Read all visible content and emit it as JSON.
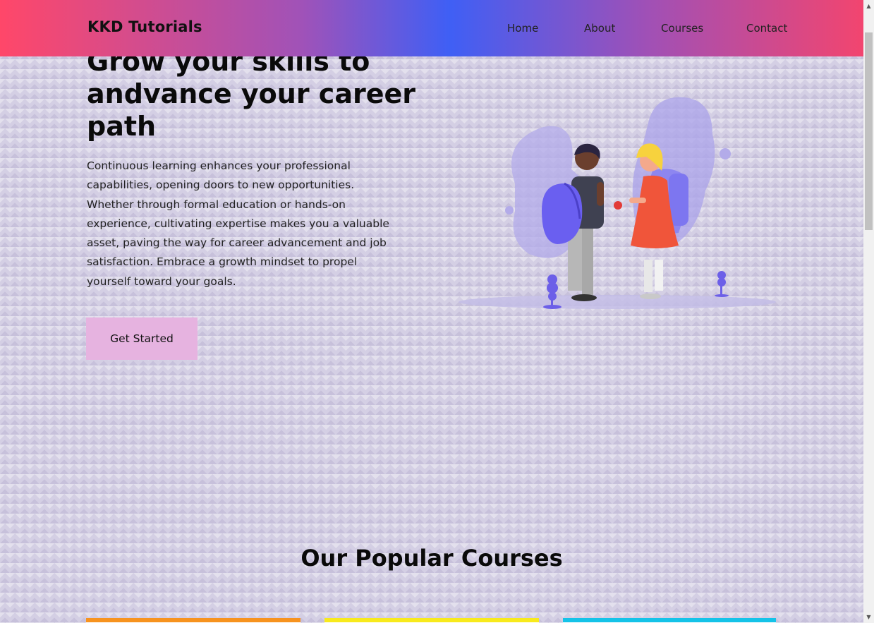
{
  "header": {
    "brand": "KKD Tutorials",
    "nav": [
      {
        "label": "Home"
      },
      {
        "label": "About"
      },
      {
        "label": "Courses"
      },
      {
        "label": "Contact"
      }
    ]
  },
  "hero": {
    "title": "Grow your skills to andvance your career path",
    "description": "Continuous learning enhances your professional capabilities, opening doors to new opportunities. Whether through formal education or hands-on experience, cultivating expertise makes you a valuable asset, paving the way for career advancement and job satisfaction. Embrace a growth mindset to propel yourself toward your goals.",
    "cta_label": "Get Started"
  },
  "courses": {
    "title": "Our Popular Courses",
    "card_colors": [
      "#f7931e",
      "#f8ea1c",
      "#14c3e8"
    ]
  },
  "scrollbar": {
    "up_icon": "triangle-up-icon",
    "down_icon": "triangle-down-icon"
  }
}
